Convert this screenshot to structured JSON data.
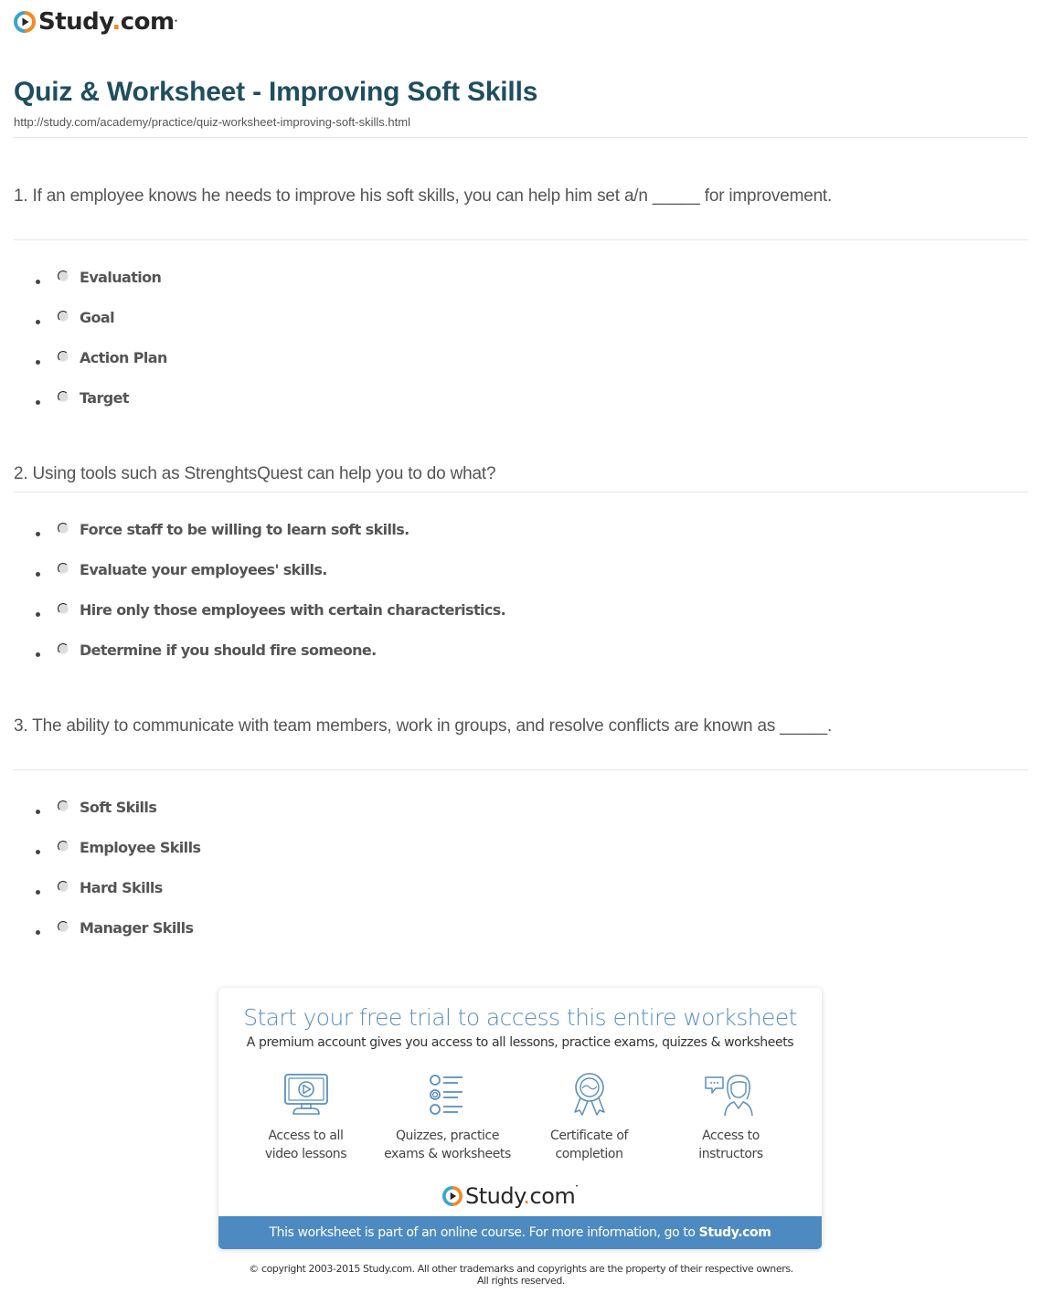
{
  "header": {
    "logo_text": "Study",
    "logo_dot": ".",
    "logo_tld": "com",
    "title": "Quiz & Worksheet - Improving Soft Skills",
    "url": "http://study.com/academy/practice/quiz-worksheet-improving-soft-skills.html"
  },
  "questions": [
    {
      "text": "1. If an employee knows he needs to improve his soft skills, you can help him set a/n _____ for improvement.",
      "options": [
        "Evaluation",
        "Goal",
        "Action Plan",
        "Target"
      ]
    },
    {
      "text": "2. Using tools such as StrenghtsQuest can help you to do what?",
      "options": [
        "Force staff to be willing to learn soft skills.",
        "Evaluate your employees' skills.",
        "Hire only those employees with certain characteristics.",
        "Determine if you should fire someone."
      ]
    },
    {
      "text": "3. The ability to communicate with team members, work in groups, and resolve conflicts are known as _____.",
      "options": [
        "Soft Skills",
        "Employee Skills",
        "Hard Skills",
        "Manager Skills"
      ]
    }
  ],
  "promo": {
    "title": "Start your free trial to access this entire worksheet",
    "subtitle": "A premium account gives you access to all lessons, practice exams, quizzes & worksheets",
    "features": [
      {
        "icon": "video-monitor-icon",
        "line1": "Access to all",
        "line2": "video lessons"
      },
      {
        "icon": "quiz-list-icon",
        "line1": "Quizzes, practice",
        "line2": "exams & worksheets"
      },
      {
        "icon": "certificate-ribbon-icon",
        "line1": "Certificate of",
        "line2": "completion"
      },
      {
        "icon": "instructor-chat-icon",
        "line1": "Access to",
        "line2": "instructors"
      }
    ],
    "bar_text": "This worksheet is part of an online course. For more information, go to ",
    "bar_link": "Study.com"
  },
  "footer": {
    "copyright_line1": "© copyright 2003-2015 Study.com. All other trademarks and copyrights are the property of their respective owners.",
    "copyright_line2": "All rights reserved."
  },
  "colors": {
    "title": "#1f4e5f",
    "promo_title": "#5a8fbd",
    "promo_bar": "#4d8ac2",
    "logo_orange": "#f28a23",
    "logo_teal": "#3aa6c9"
  }
}
